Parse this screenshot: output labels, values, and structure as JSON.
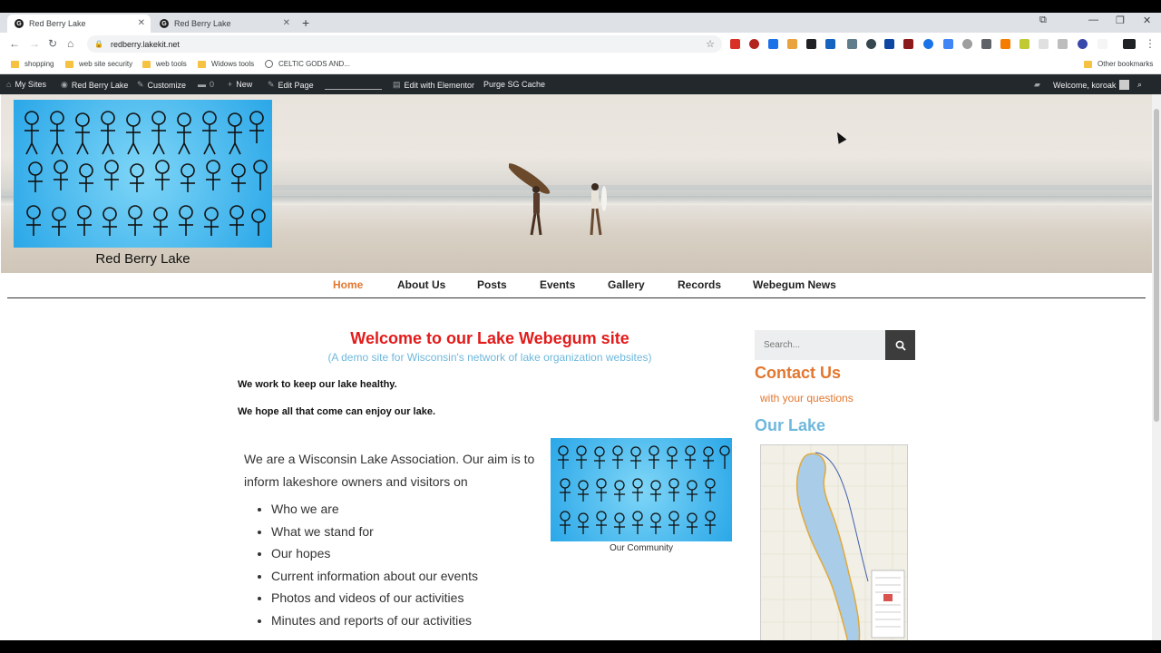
{
  "browser": {
    "tabs": [
      {
        "title": "Red Berry Lake",
        "active": true
      },
      {
        "title": "Red Berry Lake",
        "active": false
      }
    ],
    "url": "redberry.lakekit.net",
    "bookmarks": [
      "shopping",
      "web site security",
      "web tools",
      "Widows tools",
      "CELTIC GODS AND...",
      "Other bookmarks"
    ]
  },
  "adminbar": {
    "my_sites": "My Sites",
    "site": "Red Berry Lake",
    "customize": "Customize",
    "comments": "0",
    "new": "New",
    "edit_page": "Edit Page",
    "elementor": "Edit with Elementor",
    "purge": "Purge SG Cache",
    "welcome": "Welcome, koroak"
  },
  "header": {
    "site_title": "Red Berry Lake"
  },
  "nav": {
    "items": [
      "Home",
      "About Us",
      "Posts",
      "Events",
      "Gallery",
      "Records",
      "Webegum News"
    ],
    "active": "Home"
  },
  "main": {
    "headline": "Welcome to our Lake Webegum site",
    "subline": "(A demo site for Wisconsin's network of lake organization websites)",
    "p1": "We work to keep our lake healthy.",
    "p2": "We hope all that come can enjoy our lake.",
    "intro": "We are a Wisconsin Lake Association. Our aim is to inform lakeshore owners and visitors on",
    "bullets": [
      "Who we are",
      "What we stand for",
      "Our hopes",
      "Current information about our events",
      "Photos and videos of our activities",
      "Minutes and reports of our activities"
    ],
    "image_caption": "Our Community"
  },
  "sidebar": {
    "search_placeholder": "Search...",
    "contact_heading": "Contact Us",
    "contact_sub": "with your questions",
    "lake_heading": "Our Lake"
  },
  "colors": {
    "accent_orange": "#e27730",
    "headline_red": "#e31b1b",
    "light_blue": "#6fb8dc",
    "adminbar": "#23282d"
  }
}
